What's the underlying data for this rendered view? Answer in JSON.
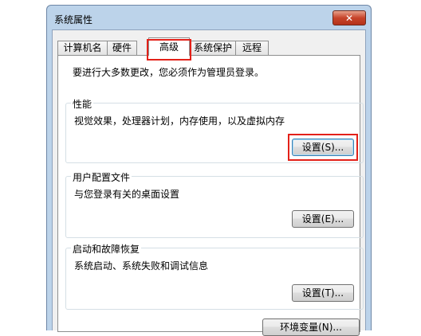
{
  "window": {
    "title": "系统属性",
    "close_symbol": "✕"
  },
  "tabs": [
    {
      "label": "计算机名",
      "active": false
    },
    {
      "label": "硬件",
      "active": false
    },
    {
      "label": "高级",
      "active": true
    },
    {
      "label": "系统保护",
      "active": false
    },
    {
      "label": "远程",
      "active": false
    }
  ],
  "advanced": {
    "intro": "要进行大多数更改，您必须作为管理员登录。",
    "performance": {
      "title": "性能",
      "description": "视觉效果，处理器计划，内存使用，以及虚拟内存",
      "button": "设置(S)..."
    },
    "user_profiles": {
      "title": "用户配置文件",
      "description": "与您登录有关的桌面设置",
      "button": "设置(E)..."
    },
    "startup_recovery": {
      "title": "启动和故障恢复",
      "description": "系统启动、系统失败和调试信息",
      "button": "设置(T)..."
    },
    "env_button": "环境变量(N)..."
  },
  "colors": {
    "highlight": "#e32119",
    "title_bar": "#bcd3ea",
    "close_button": "#c7442a"
  },
  "icons": {
    "close": "close-icon"
  }
}
